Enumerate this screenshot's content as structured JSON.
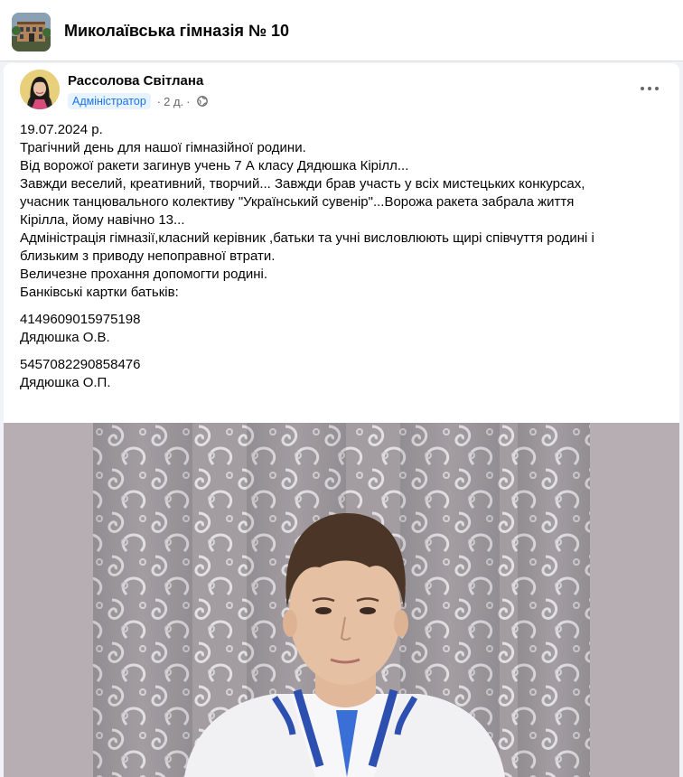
{
  "group": {
    "name": "Миколаївська гімназія № 10",
    "thumb_icon": "school-building-image"
  },
  "post": {
    "author": "Рассолова Світлана",
    "role": "Адміністратор",
    "time": "2 д.",
    "separator": "·",
    "audience_icon": "globe-icon",
    "more_icon": "more-options-icon",
    "lines": [
      "19.07.2024 р.",
      "Трагічний день для нашої гімназійної родини.",
      "Від ворожої ракети загинув учень 7 А класу Дядюшка Кірілл...",
      "Завжди веселий, креативний, творчий... Завжди брав участь у  всіх мистецьких конкурсах,",
      "учасник танцювального колективу \"Український сувенір\"...Ворожа ракета забрала життя",
      "Кірілла, йому навічно 13...",
      "Адміністрація гімназії,класний керівник ,батьки та учні висловлюють щирі співчуття родині і",
      "близьким з приводу непоправної втрати.",
      "Величезне прохання  допомогти родині.",
      "Банківські картки батьків:"
    ],
    "card1_number": "4149609015975198",
    "card1_name": "Дядюшка О.В.",
    "card2_number": "5457082290858476",
    "card2_name": "Дядюшка О.П.",
    "photo": "portrait-photo-of-boy-in-embroidered-shirt"
  },
  "colors": {
    "accent": "#1b74e4",
    "badge_bg": "#e7f3ff",
    "secondary_text": "#65676b",
    "page_bg": "#f0f2f5"
  }
}
